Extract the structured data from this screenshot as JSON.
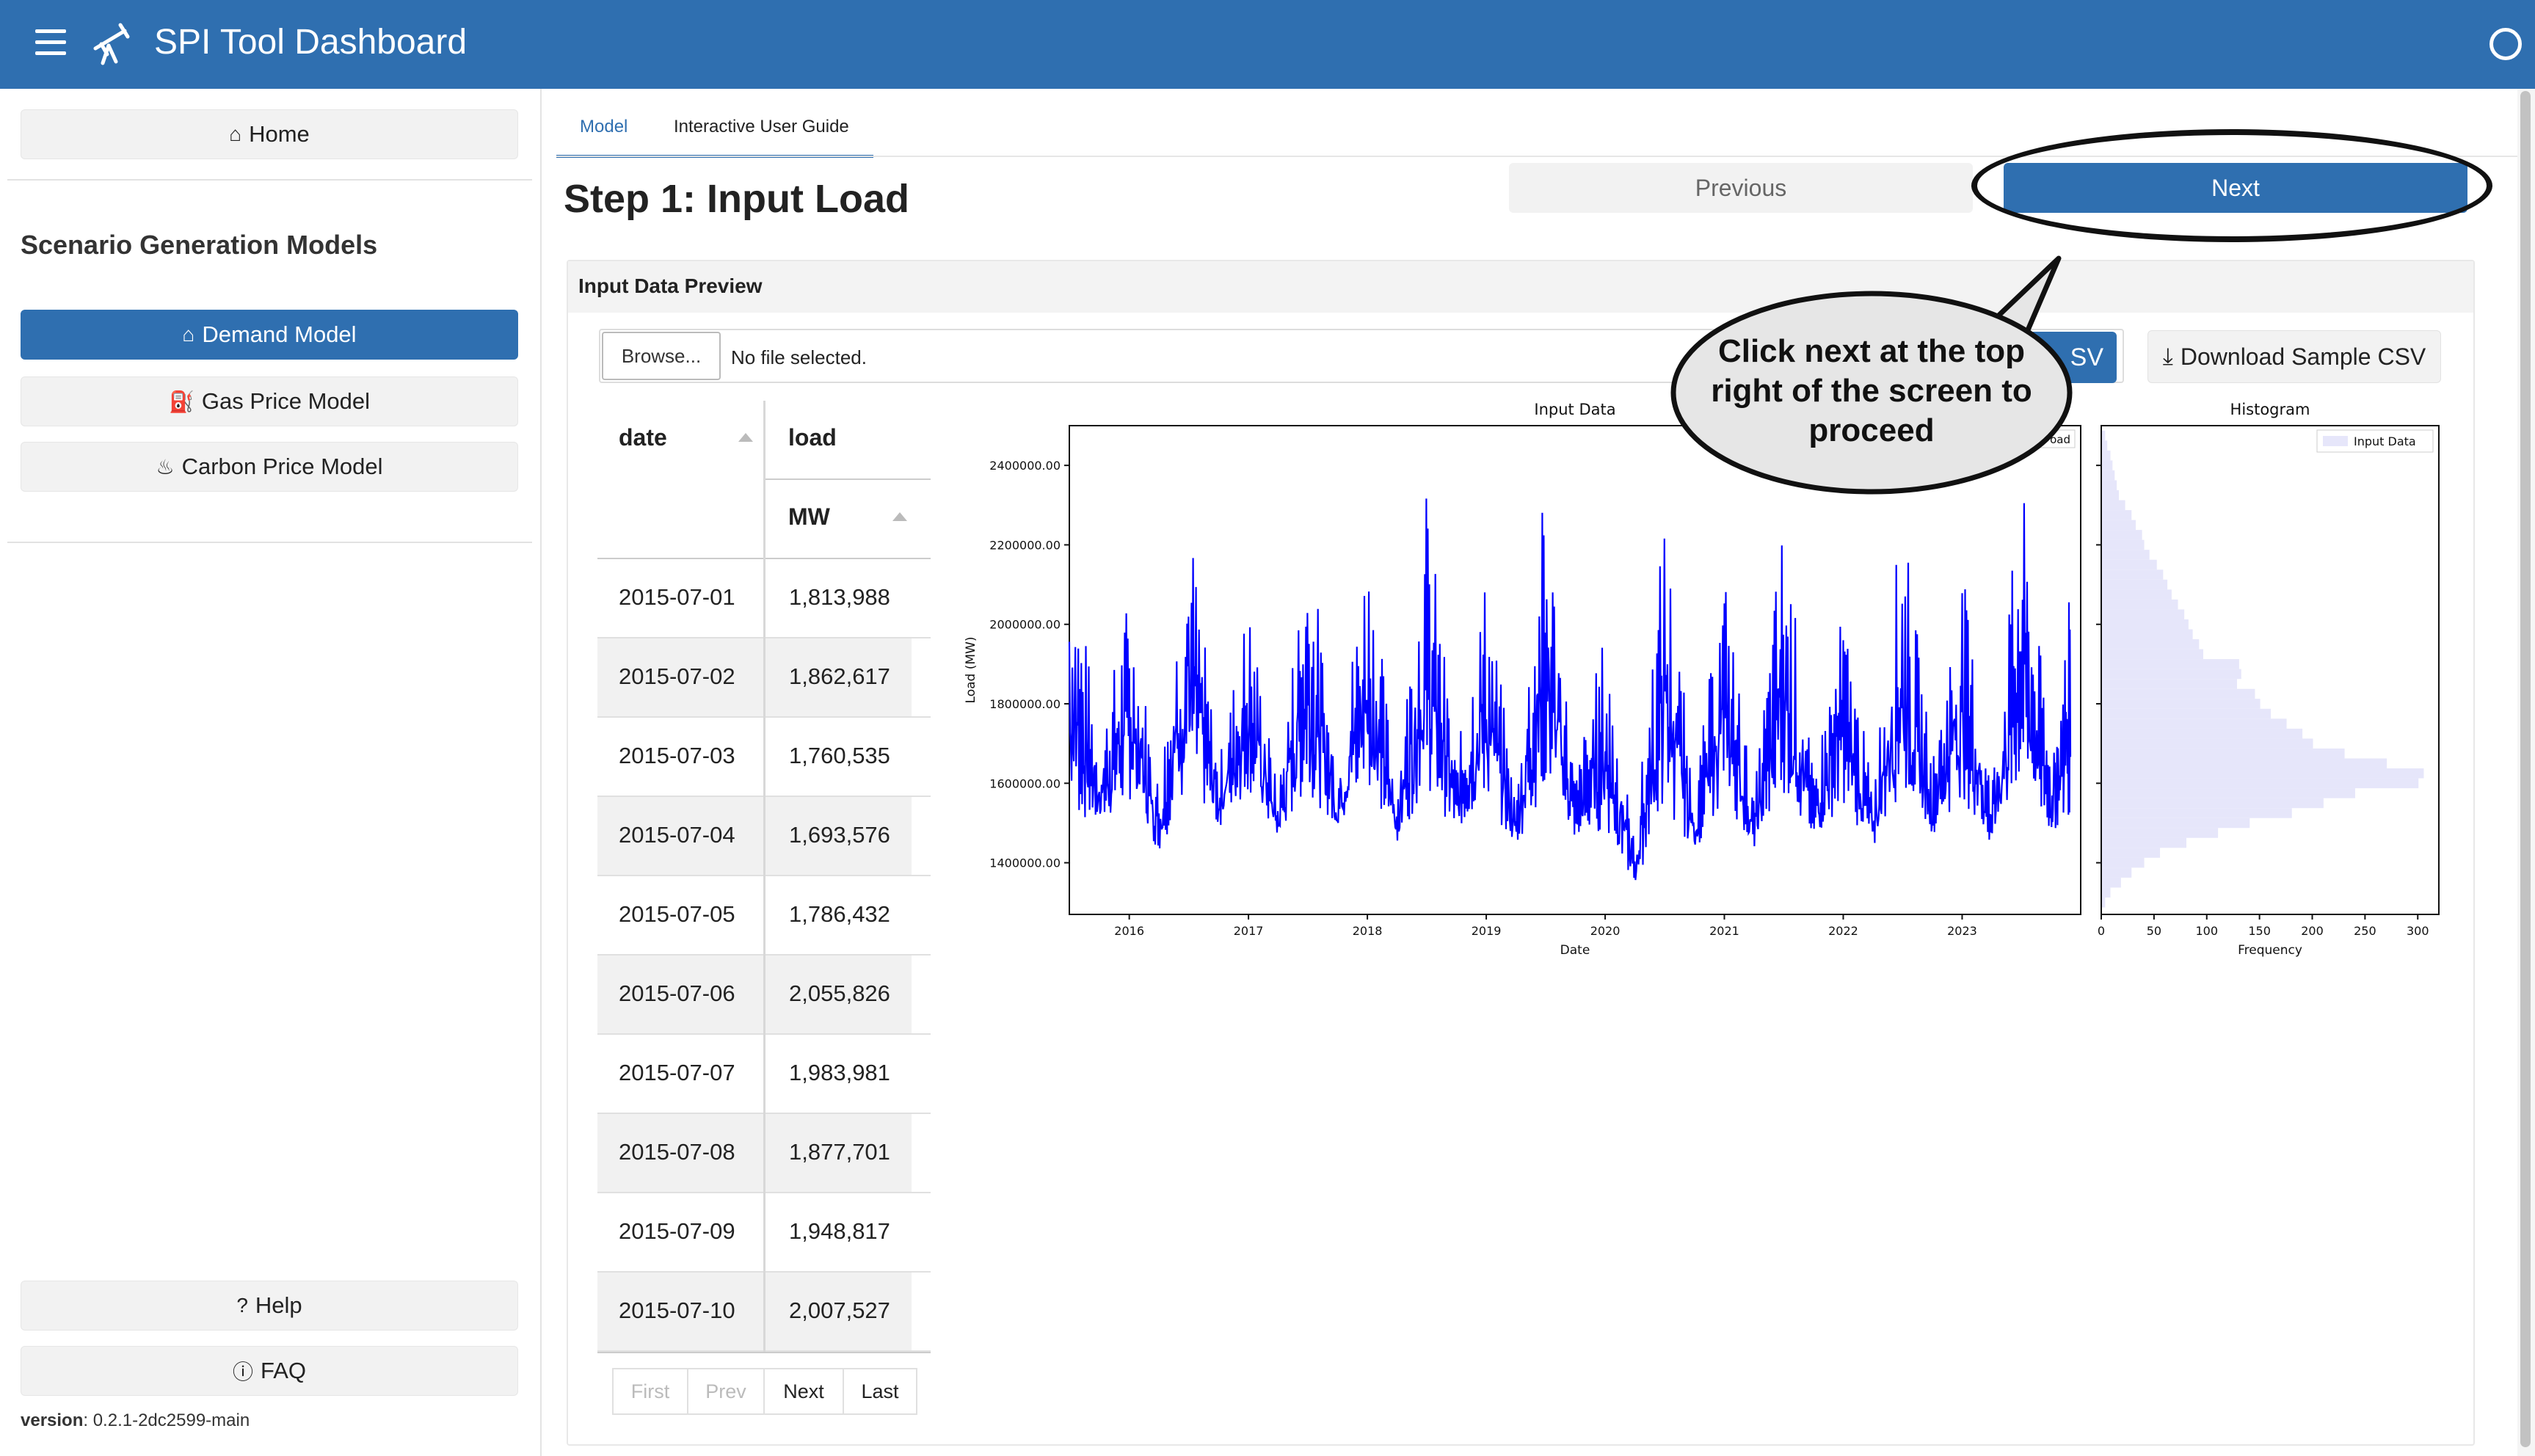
{
  "app": {
    "title": "SPI Tool Dashboard"
  },
  "sidebar": {
    "home_label": "Home",
    "section_heading": "Scenario Generation Models",
    "models": [
      {
        "label": "Demand Model",
        "icon": "house-icon",
        "active": true
      },
      {
        "label": "Gas Price Model",
        "icon": "fuel-pump-icon",
        "active": false
      },
      {
        "label": "Carbon Price Model",
        "icon": "flame-icon",
        "active": false
      }
    ],
    "help_label": "Help",
    "faq_label": "FAQ",
    "version_key": "version",
    "version_value": ": 0.2.1-2dc2599-main"
  },
  "tabs": [
    {
      "label": "Model",
      "active": true
    },
    {
      "label": "Interactive User Guide",
      "active": false
    }
  ],
  "step": {
    "title": "Step 1: Input Load",
    "previous_label": "Previous",
    "next_label": "Next"
  },
  "input_card": {
    "title": "Input Data Preview",
    "browse_label": "Browse...",
    "file_status": "No file selected.",
    "upload_label_fragment": "SV",
    "download_label": "Download Sample CSV"
  },
  "callout": {
    "lines": [
      "Click next at the top",
      "right of the screen to",
      "proceed"
    ]
  },
  "table": {
    "col_date": "date",
    "col_load": "load",
    "col_unit": "MW",
    "rows": [
      {
        "date": "2015-07-01",
        "load": "1,813,988"
      },
      {
        "date": "2015-07-02",
        "load": "1,862,617"
      },
      {
        "date": "2015-07-03",
        "load": "1,760,535"
      },
      {
        "date": "2015-07-04",
        "load": "1,693,576"
      },
      {
        "date": "2015-07-05",
        "load": "1,786,432"
      },
      {
        "date": "2015-07-06",
        "load": "2,055,826"
      },
      {
        "date": "2015-07-07",
        "load": "1,983,981"
      },
      {
        "date": "2015-07-08",
        "load": "1,877,701"
      },
      {
        "date": "2015-07-09",
        "load": "1,948,817"
      },
      {
        "date": "2015-07-10",
        "load": "2,007,527"
      }
    ],
    "pager": {
      "first": "First",
      "prev": "Prev",
      "next": "Next",
      "last": "Last"
    }
  },
  "chart_data": [
    {
      "type": "line",
      "title": "Input Data",
      "xlabel": "Date",
      "ylabel": "Load (MW)",
      "x_ticks": [
        "2016",
        "2017",
        "2018",
        "2019",
        "2020",
        "2021",
        "2022",
        "2023"
      ],
      "y_ticks": [
        "1400000.00",
        "1600000.00",
        "1800000.00",
        "2000000.00",
        "2200000.00",
        "2400000.00"
      ],
      "ylim": [
        1270000,
        2500000
      ],
      "xlim": [
        "2015-07-01",
        "2023-12-31"
      ],
      "color": "#0000ff",
      "legend_fragment": "oad",
      "series": [
        {
          "values_note": "approximate seasonal envelope",
          "x": [
            "2015-07",
            "2015-10",
            "2016-01",
            "2016-04",
            "2016-07",
            "2016-10",
            "2017-01",
            "2017-04",
            "2017-07",
            "2017-10",
            "2018-01",
            "2018-04",
            "2018-07",
            "2018-10",
            "2019-01",
            "2019-04",
            "2019-07",
            "2019-10",
            "2020-01",
            "2020-04",
            "2020-07",
            "2020-10",
            "2021-01",
            "2021-04",
            "2021-07",
            "2021-10",
            "2022-01",
            "2022-04",
            "2022-07",
            "2022-10",
            "2023-01",
            "2023-04",
            "2023-07",
            "2023-10",
            "2023-12"
          ],
          "values": [
            2300000,
            1700000,
            2100000,
            1600000,
            2320000,
            1650000,
            2080000,
            1580000,
            2280000,
            1640000,
            2250000,
            1600000,
            2350000,
            1660000,
            2150000,
            1560000,
            2380000,
            1620000,
            2000000,
            1450000,
            2300000,
            1580000,
            2150000,
            1560000,
            2300000,
            1620000,
            2050000,
            1600000,
            2300000,
            1660000,
            2150000,
            1600000,
            2380000,
            1680000,
            2100000
          ],
          "low": [
            1400000,
            1450000,
            1470000,
            1400000,
            1470000,
            1460000,
            1500000,
            1430000,
            1470000,
            1450000,
            1480000,
            1420000,
            1470000,
            1440000,
            1460000,
            1420000,
            1460000,
            1430000,
            1400000,
            1320000,
            1420000,
            1400000,
            1470000,
            1410000,
            1460000,
            1430000,
            1470000,
            1400000,
            1460000,
            1440000,
            1470000,
            1410000,
            1470000,
            1440000,
            1430000
          ]
        }
      ]
    },
    {
      "type": "bar",
      "orientation": "horizontal",
      "title": "Histogram",
      "xlabel": "Frequency",
      "x_ticks": [
        "0",
        "50",
        "100",
        "150",
        "200",
        "250",
        "300"
      ],
      "xlim": [
        0,
        320
      ],
      "legend": [
        "Input Data"
      ],
      "color": "#e6e6fa",
      "bins_y": [
        2475000,
        2450000,
        2425000,
        2400000,
        2375000,
        2350000,
        2325000,
        2300000,
        2275000,
        2250000,
        2225000,
        2200000,
        2175000,
        2150000,
        2125000,
        2100000,
        2075000,
        2050000,
        2025000,
        2000000,
        1975000,
        1950000,
        1925000,
        1900000,
        1875000,
        1850000,
        1825000,
        1800000,
        1775000,
        1750000,
        1725000,
        1700000,
        1675000,
        1650000,
        1625000,
        1600000,
        1575000,
        1550000,
        1525000,
        1500000,
        1475000,
        1450000,
        1425000,
        1400000,
        1375000,
        1350000,
        1325000,
        1300000
      ],
      "values": [
        3,
        5,
        8,
        10,
        12,
        14,
        16,
        22,
        28,
        32,
        38,
        40,
        45,
        52,
        58,
        62,
        66,
        72,
        78,
        82,
        86,
        92,
        96,
        130,
        132,
        128,
        145,
        150,
        160,
        175,
        190,
        200,
        230,
        270,
        305,
        300,
        240,
        210,
        180,
        140,
        110,
        80,
        55,
        40,
        28,
        18,
        8,
        3
      ]
    }
  ]
}
